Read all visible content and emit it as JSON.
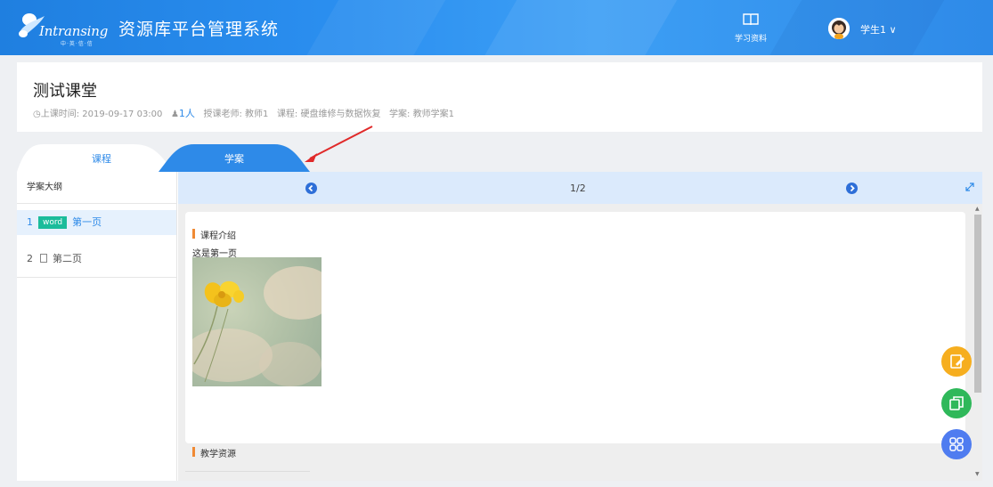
{
  "header": {
    "brand": "Intransing",
    "brand_sub": "中·英·信·信",
    "app_title": "资源库平台管理系统",
    "study_label": "学习资料",
    "user_name": "学生1 ∨"
  },
  "lesson": {
    "title": "测试课堂",
    "time": "上课时间: 2019-09-17 03:00",
    "count": "1人",
    "teacher": "授课老师: 教师1",
    "course": "课程: 硬盘维修与数据恢复",
    "plan": "学案: 教师学案1"
  },
  "tabs": [
    {
      "label": "课程"
    },
    {
      "label": "学案"
    }
  ],
  "outline": {
    "header": "学案大纲",
    "items": [
      {
        "num": "1",
        "badge": "word",
        "label": "第一页"
      },
      {
        "num": "2",
        "label": "第二页"
      }
    ]
  },
  "pager": {
    "text": "1/2"
  },
  "content": {
    "section_title": "课程介绍",
    "text": "这是第一页",
    "resources_title": "教学资源"
  },
  "colors": {
    "header": "#2b8ff0",
    "accent": "#2e8ae8",
    "badge": "#1bbc9b",
    "fab_note": "#f6ae1f",
    "fab_copy": "#2fb85a",
    "fab_grid": "#4f7cf0",
    "arrow": "#e02a2a"
  },
  "icons": [
    "book-icon",
    "user-avatar-icon",
    "left-circle-icon",
    "right-circle-icon",
    "expand-icon",
    "edit-note-icon",
    "copy-icon",
    "grid-apps-icon",
    "document-icon"
  ]
}
